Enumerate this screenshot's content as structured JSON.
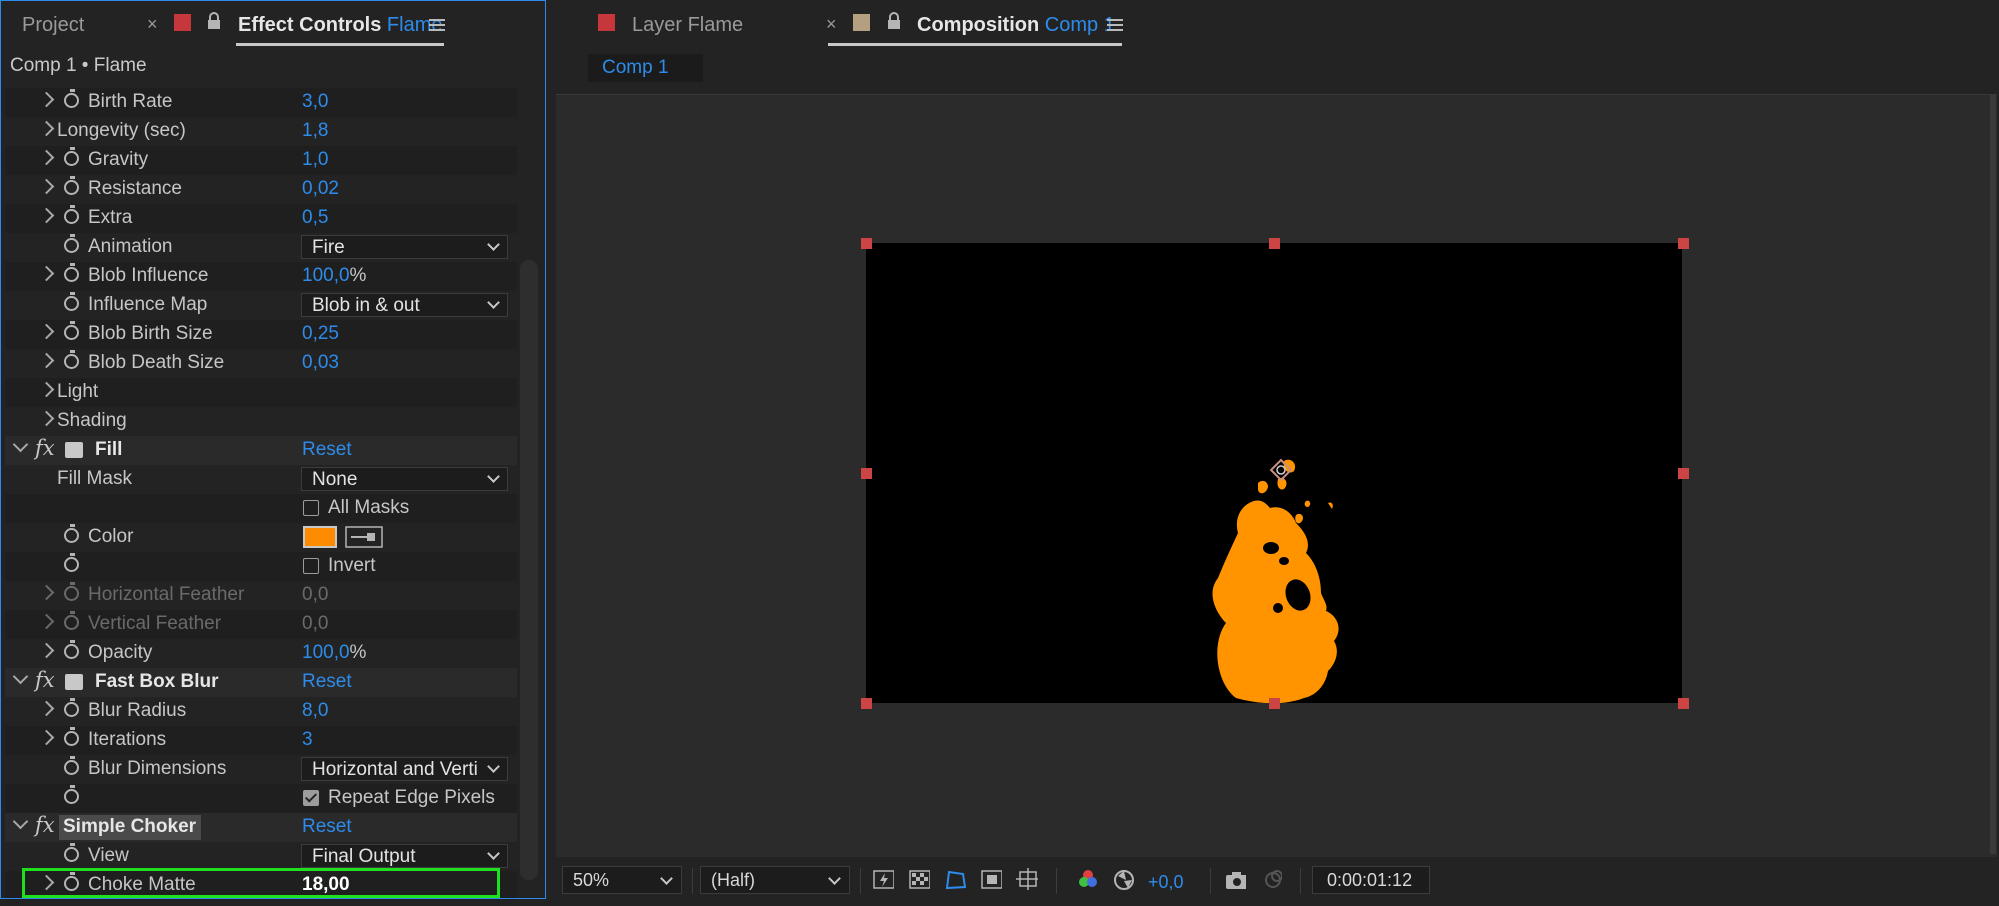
{
  "left_tabs": {
    "project": "Project",
    "effect_controls": "Effect Controls",
    "effect_controls_layer": "Flame"
  },
  "breadcrumb": "Comp 1 • Flame",
  "rows": [
    {
      "label": "Birth Rate",
      "value": "3,0"
    },
    {
      "label": "Longevity (sec)",
      "value": "1,8"
    },
    {
      "label": "Gravity",
      "value": "1,0"
    },
    {
      "label": "Resistance",
      "value": "0,02"
    },
    {
      "label": "Extra",
      "value": "0,5"
    },
    {
      "label": "Animation",
      "dropdown": "Fire"
    },
    {
      "label": "Blob Influence",
      "value": "100,0",
      "unit": "%"
    },
    {
      "label": "Influence Map",
      "dropdown": "Blob in & out"
    },
    {
      "label": "Blob Birth Size",
      "value": "0,25"
    },
    {
      "label": "Blob Death Size",
      "value": "0,03"
    },
    {
      "label": "Light"
    },
    {
      "label": "Shading"
    },
    {
      "label": "Fill",
      "reset": "Reset"
    },
    {
      "label": "Fill Mask",
      "dropdown": "None"
    },
    {
      "checkbox": "All Masks"
    },
    {
      "label": "Color",
      "color": "#ff8c00"
    },
    {
      "checkbox": "Invert"
    },
    {
      "label": "Horizontal Feather",
      "value": "0,0"
    },
    {
      "label": "Vertical Feather",
      "value": "0,0"
    },
    {
      "label": "Opacity",
      "value": "100,0",
      "unit": "%"
    },
    {
      "label": "Fast Box Blur",
      "reset": "Reset"
    },
    {
      "label": "Blur Radius",
      "value": "8,0"
    },
    {
      "label": "Iterations",
      "value": "3"
    },
    {
      "label": "Blur Dimensions",
      "dropdown": "Horizontal and Verti"
    },
    {
      "checkbox": "Repeat Edge Pixels"
    },
    {
      "label": "Simple Choker",
      "reset": "Reset"
    },
    {
      "label": "View",
      "dropdown": "Final Output"
    },
    {
      "label": "Choke Matte",
      "value": "18,00"
    }
  ],
  "right_tabs": {
    "layer": "Layer Flame",
    "composition": "Composition",
    "composition_name": "Comp 1"
  },
  "comp_subtab": "Comp 1",
  "bottom_bar": {
    "zoom": "50%",
    "resolution": "(Half)",
    "exposure": "+0,0",
    "timecode": "0:00:01:12"
  },
  "colors": {
    "accent": "#2d8ceb",
    "flame": "#ff9400",
    "highlight": "#1ee01e",
    "handle": "#cc4444"
  }
}
